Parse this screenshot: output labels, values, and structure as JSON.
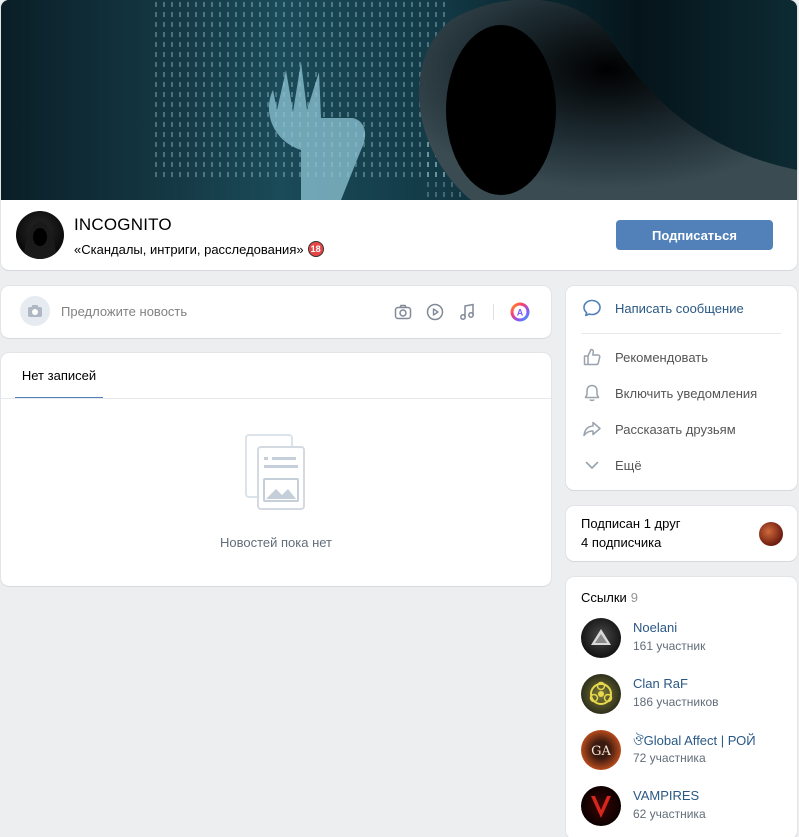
{
  "group": {
    "name": "INCOGNITO",
    "status": "«Скандалы, интриги, расследования»",
    "age_badge": "18",
    "subscribe_label": "Подписаться"
  },
  "suggest": {
    "placeholder": "Предложите новость",
    "icons": [
      "camera-icon",
      "video-icon",
      "music-icon",
      "color-avatar-icon"
    ]
  },
  "wall": {
    "tab_label": "Нет записей",
    "empty_text": "Новостей пока нет"
  },
  "actions": {
    "message": "Написать сообщение",
    "recommend": "Рекомендовать",
    "notify": "Включить уведомления",
    "share": "Рассказать друзьям",
    "more": "Ещё"
  },
  "friends": {
    "line1": "Подписан 1 друг",
    "line2": "4 подписчика"
  },
  "links": {
    "title": "Ссылки",
    "count": "9",
    "items": [
      {
        "name": "Noelani",
        "sub": "161 участник"
      },
      {
        "name": "Clan RaF",
        "sub": "186 участников"
      },
      {
        "name": "ঔGlobal Affect | РОЙ",
        "sub": "72 участника"
      },
      {
        "name": "VAMPIRES",
        "sub": "62 участника"
      }
    ]
  },
  "colors": {
    "accent": "#5181b8",
    "link": "#2a5885",
    "background": "#edeef0"
  }
}
